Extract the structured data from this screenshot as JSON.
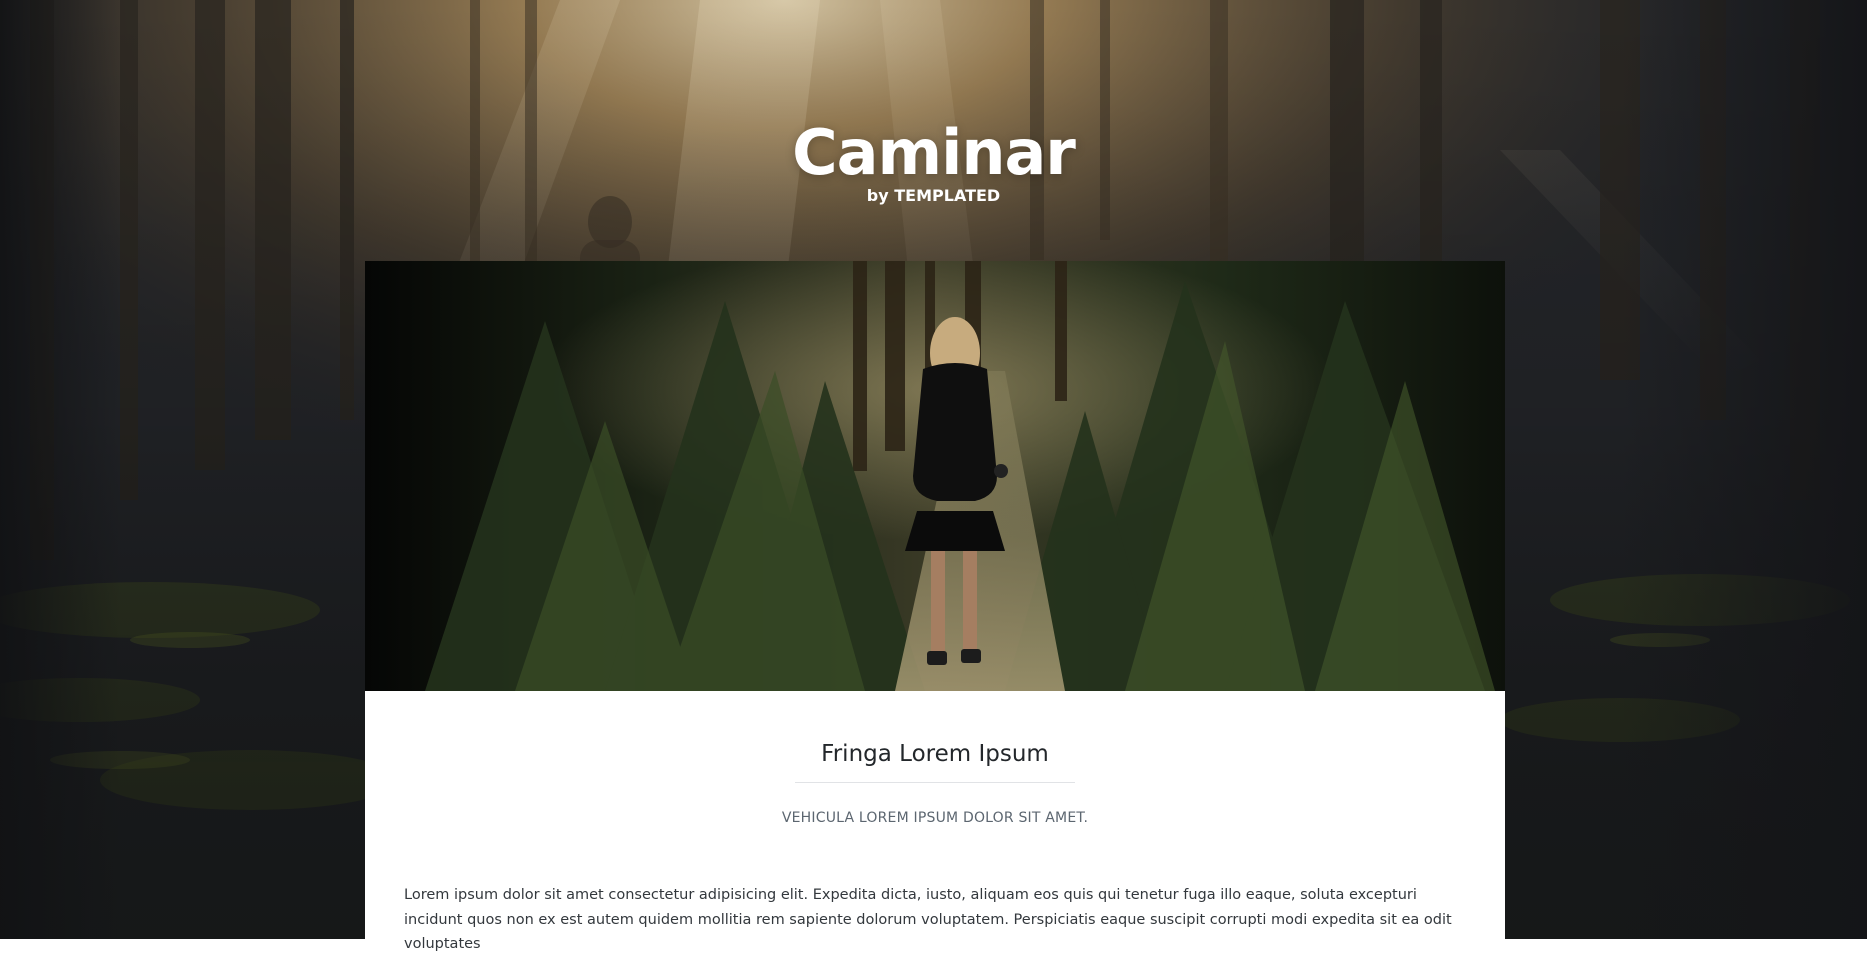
{
  "header": {
    "title": "Caminar",
    "byline": "by TEMPLATED"
  },
  "post": {
    "title": "Fringa Lorem Ipsum",
    "subtitle": "VEHICULA LOREM IPSUM DOLOR SIT AMET.",
    "body": "Lorem ipsum dolor sit amet consectetur adipisicing elit. Expedita dicta, iusto, aliquam eos quis qui tenetur fuga illo eaque, soluta excepturi incidunt quos non ex est autem quidem mollitia rem sapiente dolorum voluptatem. Perspiciatis eaque suscipit corrupti modi expedita sit ea odit voluptates"
  },
  "colors": {
    "page_background": "#1c1e22",
    "card_background": "#ffffff",
    "heading_text": "#23272b",
    "subtitle_text": "#5c6670",
    "body_text": "#33383d",
    "divider": "#e1e3e6"
  },
  "images": {
    "background": "misty-forest-background",
    "hero": "woman-walking-forest-path"
  }
}
